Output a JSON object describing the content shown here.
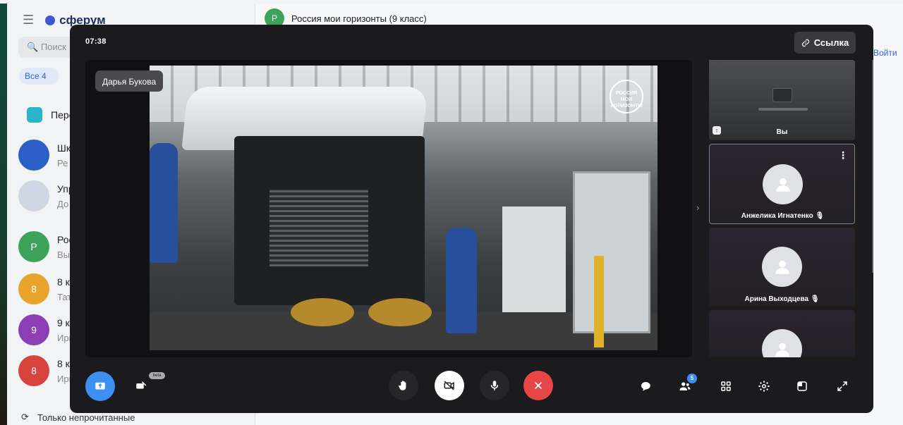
{
  "background": {
    "logo": "сферум",
    "search_placeholder": "Поиск",
    "filter_all": "Все",
    "filter_all_count": "4",
    "chats": [
      {
        "initial": "",
        "title": "Пере",
        "sub": "",
        "color": "#2bb3c9"
      },
      {
        "initial": "",
        "title": "Шк",
        "sub": "Ре",
        "color": "#2d5fc9"
      },
      {
        "initial": "",
        "title": "Упр",
        "sub": "До",
        "color": "#cfd6e4"
      },
      {
        "initial": "Р",
        "title": "Рос",
        "sub": "Вы",
        "color": "#3ea35a"
      },
      {
        "initial": "8",
        "title": "8 к",
        "sub": "Тат",
        "color": "#e8a42a"
      },
      {
        "initial": "9",
        "title": "9 к",
        "sub": "Ири",
        "color": "#8c3fb4"
      },
      {
        "initial": "8",
        "title": "8 к",
        "sub": "Ири",
        "color": "#d8433b"
      }
    ],
    "unread_toggle_label": "Только непрочитанные",
    "chat_title": "Россия мои горизонты (9 класс)",
    "chat_avatar_initial": "Р",
    "login_link": "Войти"
  },
  "call": {
    "timer": "07:38",
    "link_button": "Ссылка",
    "speaker_label": "Дарья Букова",
    "watermark": "РОССИЯ МОИ ГОРИЗОНТЫ",
    "participants": [
      {
        "name": "Вы",
        "self": true
      },
      {
        "name": "Анжелика Игнатенко",
        "muted": true
      },
      {
        "name": "Арина Выходцева",
        "muted": true
      },
      {
        "name": "",
        "muted": false
      }
    ],
    "participants_count": "5",
    "beta_label": "beta",
    "colors": {
      "share": "#3d8ff1",
      "end_call": "#e64646",
      "panel": "#1b1b1d"
    }
  }
}
